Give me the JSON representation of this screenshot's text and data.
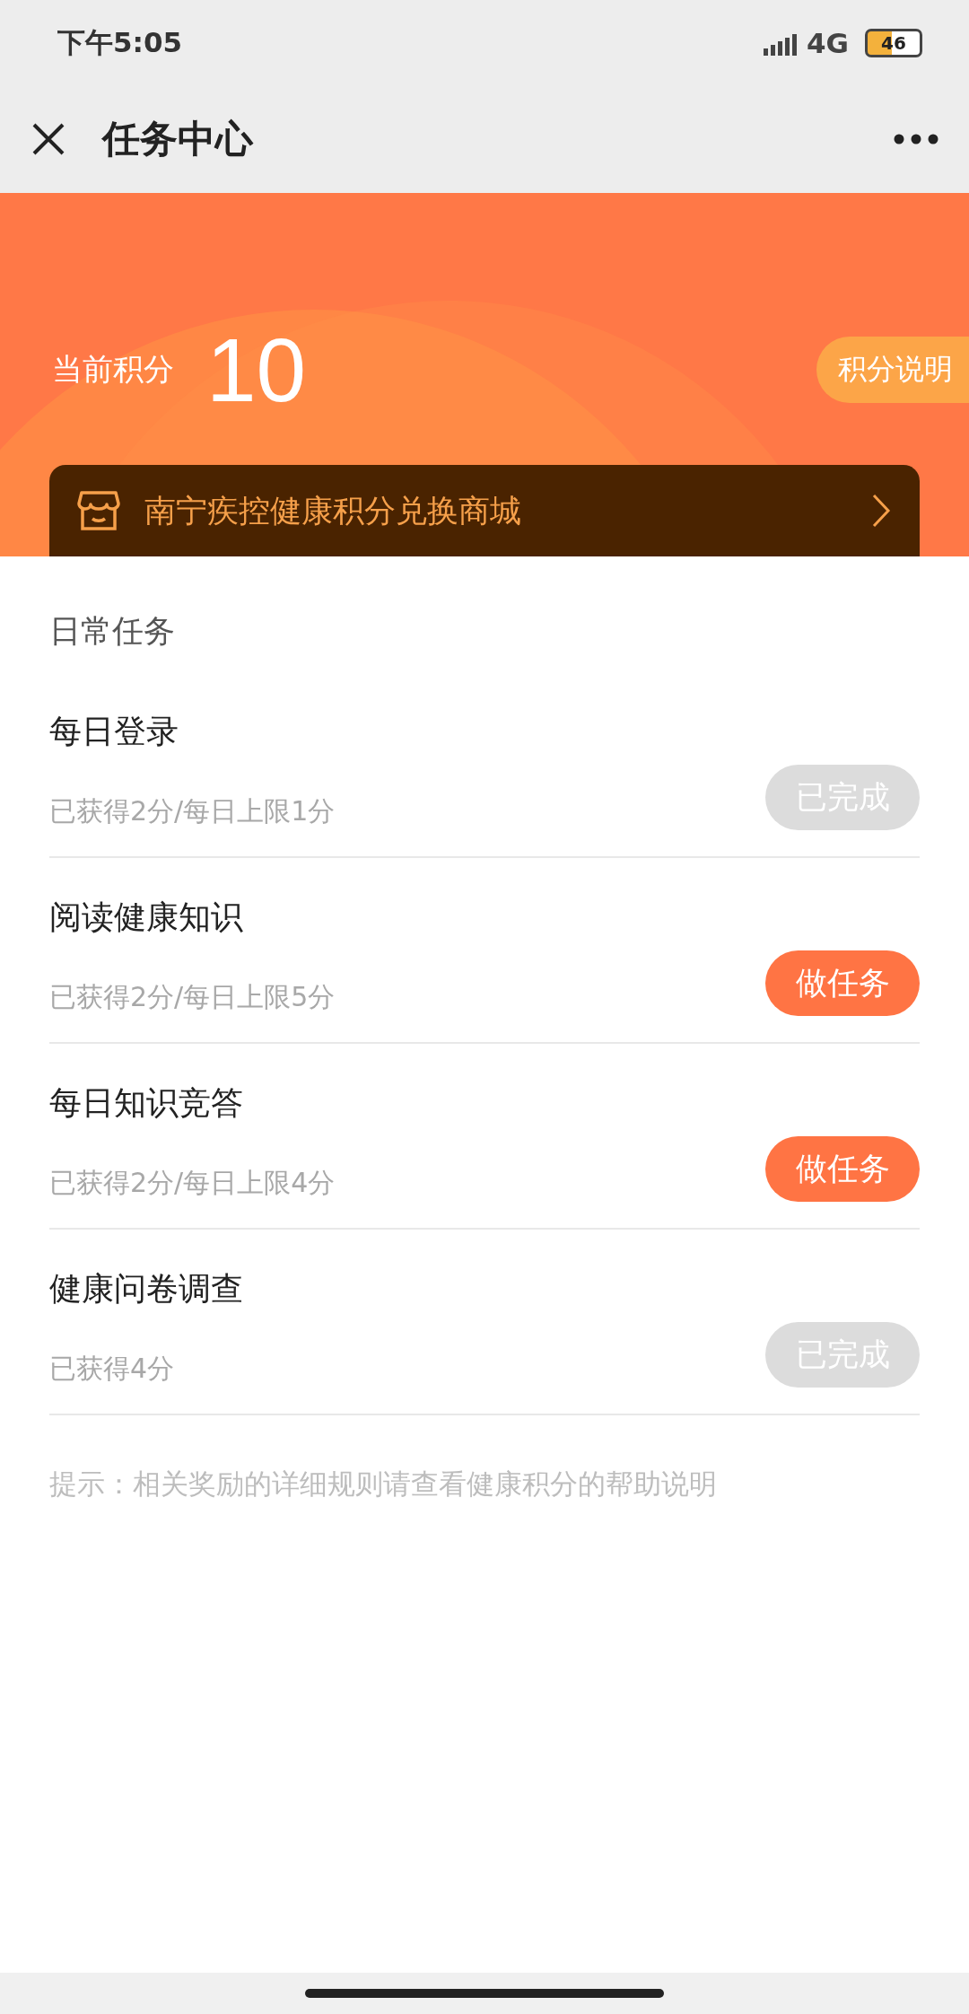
{
  "status_bar": {
    "time": "下午5:05",
    "network": "4G",
    "battery": "46"
  },
  "nav": {
    "title": "任务中心"
  },
  "points": {
    "label": "当前积分",
    "value": "10",
    "help": "积分说明"
  },
  "mall": {
    "label": "南宁疾控健康积分兑换商城"
  },
  "section": {
    "title": "日常任务"
  },
  "tasks": [
    {
      "name": "每日登录",
      "progress": "已获得2分/每日上限1分",
      "action": {
        "kind": "done",
        "label": "已完成"
      }
    },
    {
      "name": "阅读健康知识",
      "progress": "已获得2分/每日上限5分",
      "action": {
        "kind": "todo",
        "label": "做任务"
      }
    },
    {
      "name": "每日知识竞答",
      "progress": "已获得2分/每日上限4分",
      "action": {
        "kind": "todo",
        "label": "做任务"
      }
    },
    {
      "name": "健康问卷调查",
      "progress": "已获得4分",
      "action": {
        "kind": "done",
        "label": "已完成"
      }
    }
  ],
  "tip": "提示：相关奖励的详细规则请查看健康积分的帮助说明"
}
